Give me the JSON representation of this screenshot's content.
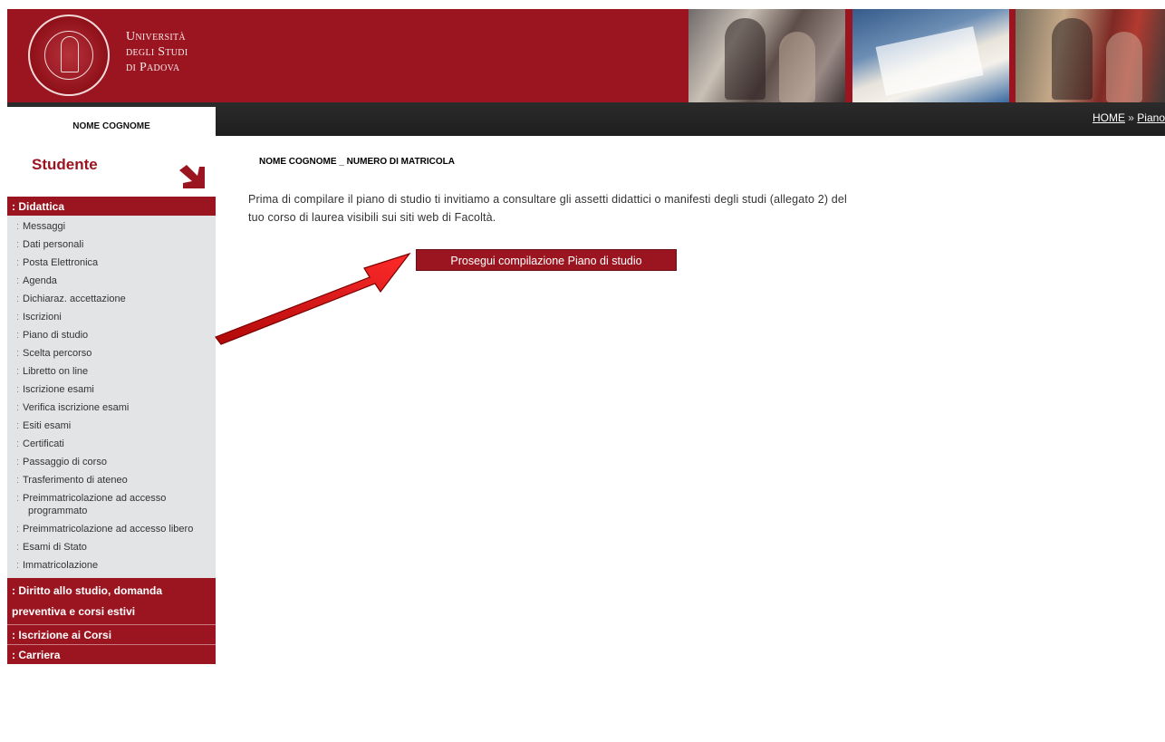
{
  "header": {
    "logo_line1": "Università",
    "logo_line2": "degli Studi",
    "logo_line3": "di Padova"
  },
  "breadcrumb": {
    "home": "HOME",
    "separator": " » ",
    "current": "Piano"
  },
  "sidebar": {
    "user_name": "NOME COGNOME",
    "role": "Studente",
    "sections": {
      "didattica": ": Didattica",
      "diritto": ": Diritto allo studio, domanda preventiva e corsi estivi",
      "iscrizione_corsi": ": Iscrizione ai Corsi",
      "carriera": ": Carriera"
    },
    "bullet": ":",
    "items": [
      "Messaggi",
      "Dati personali",
      "Posta Elettronica",
      "Agenda",
      "Dichiaraz. accettazione",
      "Iscrizioni",
      "Piano di studio",
      "Scelta percorso",
      "Libretto on line",
      "Iscrizione esami",
      "Verifica iscrizione esami",
      "Esiti esami",
      "Certificati",
      "Passaggio di corso",
      "Trasferimento di ateneo",
      "Preimmatricolazione ad accesso programmato",
      "Preimmatricolazione ad accesso libero",
      "Esami di Stato",
      "Immatricolazione"
    ]
  },
  "main": {
    "student_id": "NOME COGNOME _ NUMERO DI MATRICOLA",
    "intro": "Prima di compilare il piano di studio ti invitiamo a consultare gli assetti didattici o manifesti degli studi (allegato 2) del tuo corso di laurea visibili sui siti web di Facoltà.",
    "continue_button": "Prosegui compilazione Piano di studio"
  },
  "colors": {
    "brand": "#9b1520",
    "navbar": "#222222",
    "sidebar_bg": "#e2e4e6",
    "annotation_arrow": "#e01010"
  }
}
